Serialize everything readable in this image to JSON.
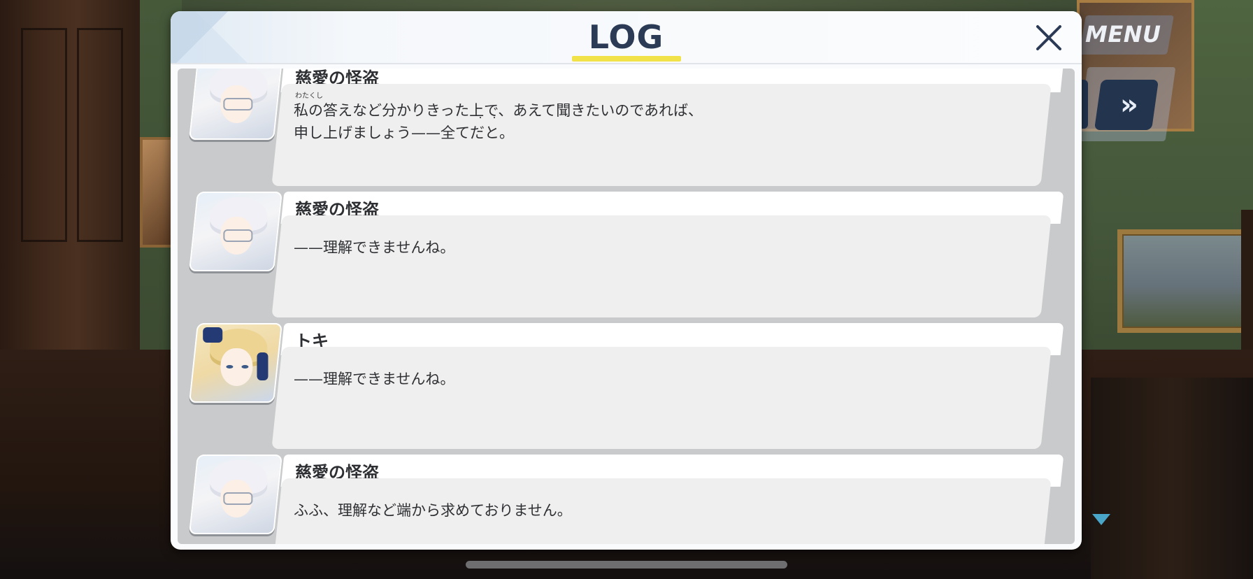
{
  "header": {
    "title": "LOG",
    "accent_color": "#f2e24a",
    "close_icon": "close-icon"
  },
  "hud": {
    "menu_label": "MENU",
    "fast_forward_icon": "fast-forward-icon",
    "fast_forward_glyph": "»",
    "next_indicator_icon": "chevron-down-icon"
  },
  "entries": [
    {
      "speaker": "慈愛の怪盗",
      "portrait": "silver-haired-character",
      "ruby": "わたくし",
      "lines": [
        "私の答えなど分かりきった上で、あえて聞きたいのであれば、",
        "申し上げましょう——全てだと。"
      ],
      "emphasis_dots": "・・"
    },
    {
      "speaker": "慈愛の怪盗",
      "portrait": "silver-haired-character",
      "lines": [
        "——理解できませんね。"
      ]
    },
    {
      "speaker": "トキ",
      "portrait": "blonde-haired-character",
      "lines": [
        "——理解できませんね。"
      ]
    },
    {
      "speaker": "慈愛の怪盗",
      "portrait": "silver-haired-character",
      "lines": [
        "ふふ、理解など端から求めておりません。"
      ]
    }
  ]
}
